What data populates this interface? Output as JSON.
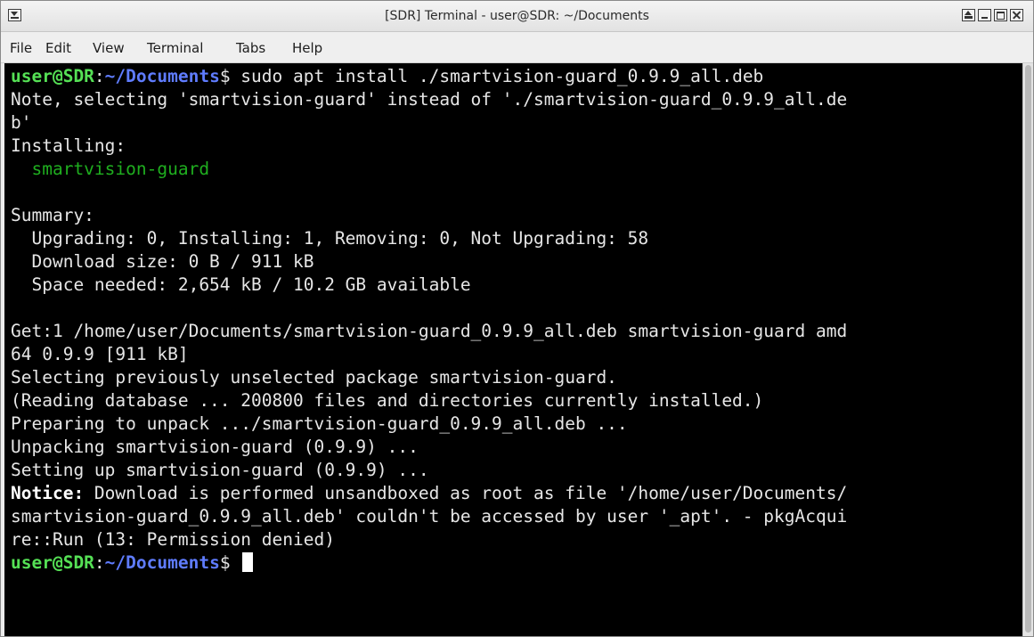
{
  "window": {
    "title": "[SDR] Terminal - user@SDR: ~/Documents"
  },
  "menu": {
    "file": "File",
    "edit": "Edit",
    "view": "View",
    "terminal": "Terminal",
    "tabs": "Tabs",
    "help": "Help"
  },
  "prompt": {
    "user": "user@SDR",
    "sep": ":",
    "path": "~/Documents",
    "symbol": "$ "
  },
  "terminal": {
    "command": "sudo apt install ./smartvision-guard_0.9.9_all.deb",
    "lines": [
      "Note, selecting 'smartvision-guard' instead of './smartvision-guard_0.9.9_all.de",
      "b'",
      "Installing:",
      "  smartvision-guard",
      "",
      "Summary:",
      "  Upgrading: 0, Installing: 1, Removing: 0, Not Upgrading: 58",
      "  Download size: 0 B / 911 kB",
      "  Space needed: 2,654 kB / 10.2 GB available",
      "",
      "Get:1 /home/user/Documents/smartvision-guard_0.9.9_all.deb smartvision-guard amd",
      "64 0.9.9 [911 kB]",
      "Selecting previously unselected package smartvision-guard.",
      "(Reading database ... 200800 files and directories currently installed.)",
      "Preparing to unpack .../smartvision-guard_0.9.9_all.deb ...",
      "Unpacking smartvision-guard (0.9.9) ...",
      "Setting up smartvision-guard (0.9.9) ...",
      "",
      "smartvision-guard_0.9.9_all.deb' couldn't be accessed by user '_apt'. - pkgAcqui",
      "re::Run (13: Permission denied)"
    ],
    "notice_label": "Notice:",
    "notice_text": " Download is performed unsandboxed as root as file '/home/user/Documents/"
  },
  "colors": {
    "prompt_user": "#55e055",
    "prompt_path": "#5f7cff",
    "package_name": "#1fae1f",
    "background": "#000000",
    "foreground": "#e6e6e6"
  }
}
